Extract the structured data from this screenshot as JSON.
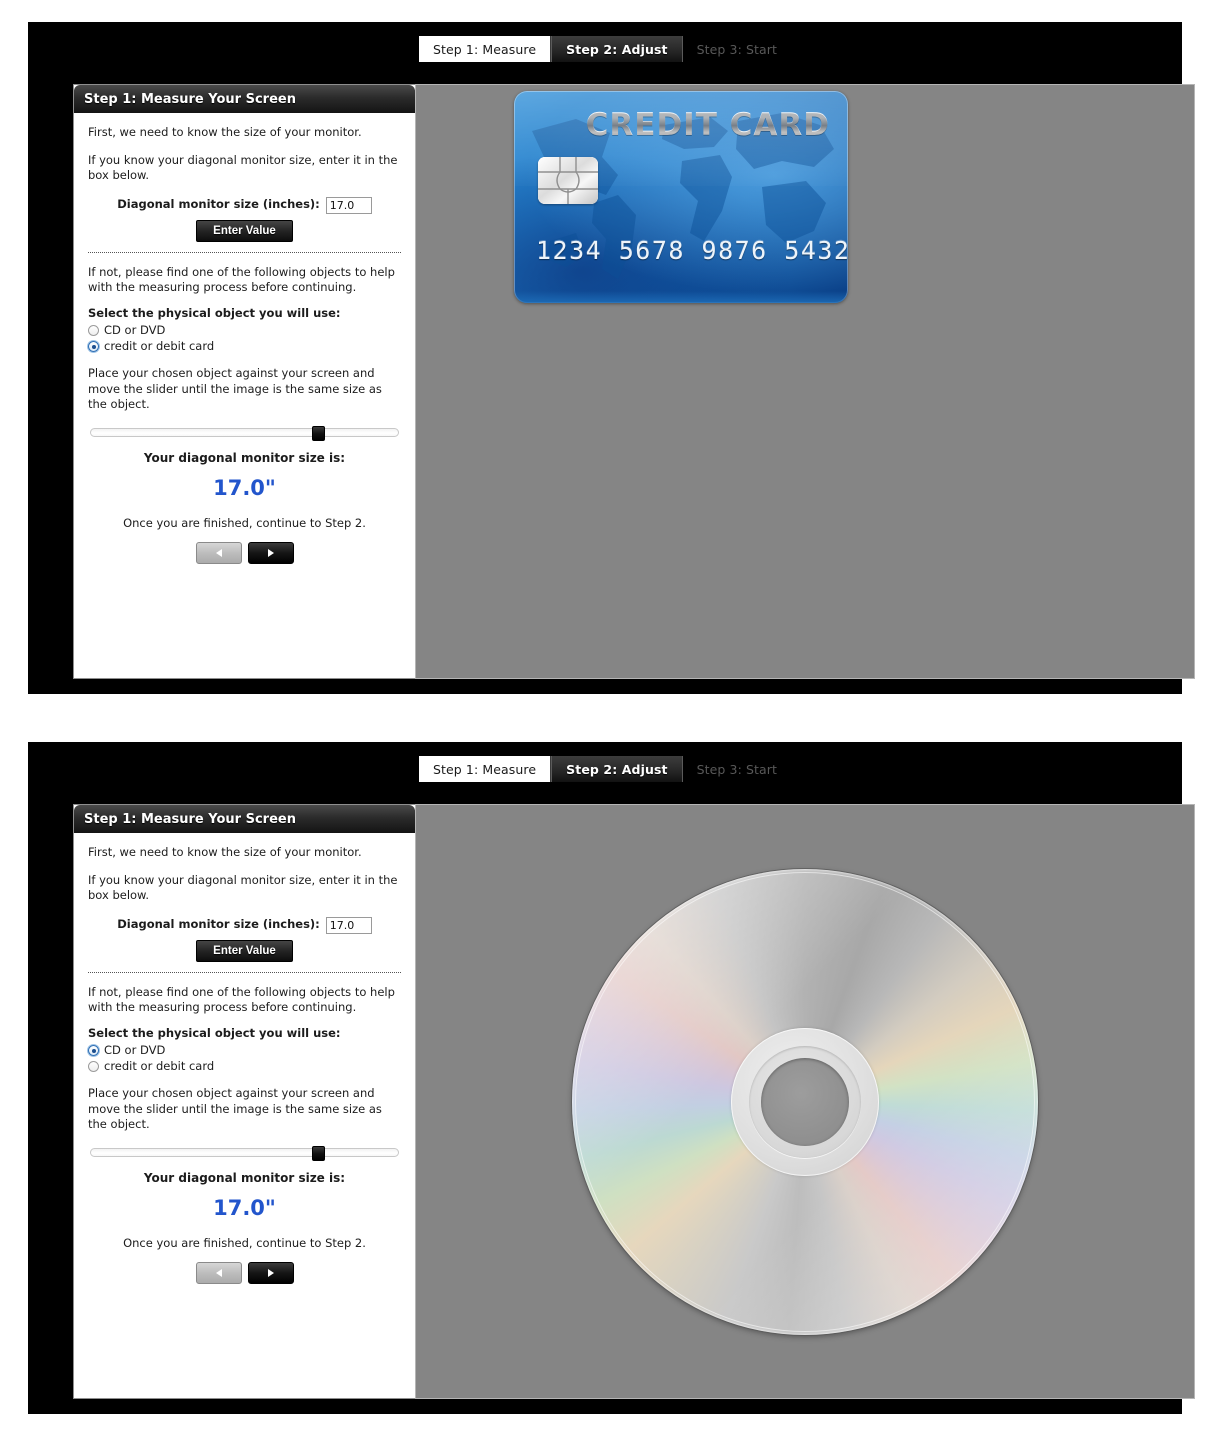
{
  "tabs": [
    {
      "label": "Step 1: Measure",
      "state": "done"
    },
    {
      "label": "Step 2: Adjust",
      "state": "active"
    },
    {
      "label": "Step 3: Start",
      "state": "upcoming"
    }
  ],
  "panel": {
    "header": "Step 1: Measure Your Screen",
    "intro_1": "First, we need to know the size of your monitor.",
    "intro_2": "If you know your diagonal monitor size, enter it in the box below.",
    "size_label": "Diagonal monitor size (inches):",
    "size_value": "17.0",
    "size_placeholder": "17.0",
    "enter_button": "Enter Value",
    "alt_text": "If not, please find one of the following objects to help with the measuring process before continuing.",
    "object_prompt": "Select the physical object you will use:",
    "option_cd": "CD or DVD",
    "option_card": "credit or debit card",
    "instruction": "Place your chosen object against your screen and move the slider until the image is the same size as the object.",
    "result_label": "Your diagonal monitor size is:",
    "result_value": "17.0\"",
    "finish_note": "Once you are finished, continue to Step 2.",
    "prev_button": "◂",
    "next_button": "▸"
  },
  "views": [
    {
      "id": "card-view",
      "selected_object": "credit or debit card",
      "slider_percent": 74,
      "credit_card": {
        "title": "CREDIT CARD",
        "number": "1234 5678 9876 5432"
      }
    },
    {
      "id": "cd-view",
      "selected_object": "CD or DVD",
      "slider_percent": 74
    }
  ],
  "colors": {
    "accent_blue": "#2255cc",
    "canvas_grey": "#858585",
    "frame_black": "#000000",
    "card_blue": "#1260ad"
  }
}
